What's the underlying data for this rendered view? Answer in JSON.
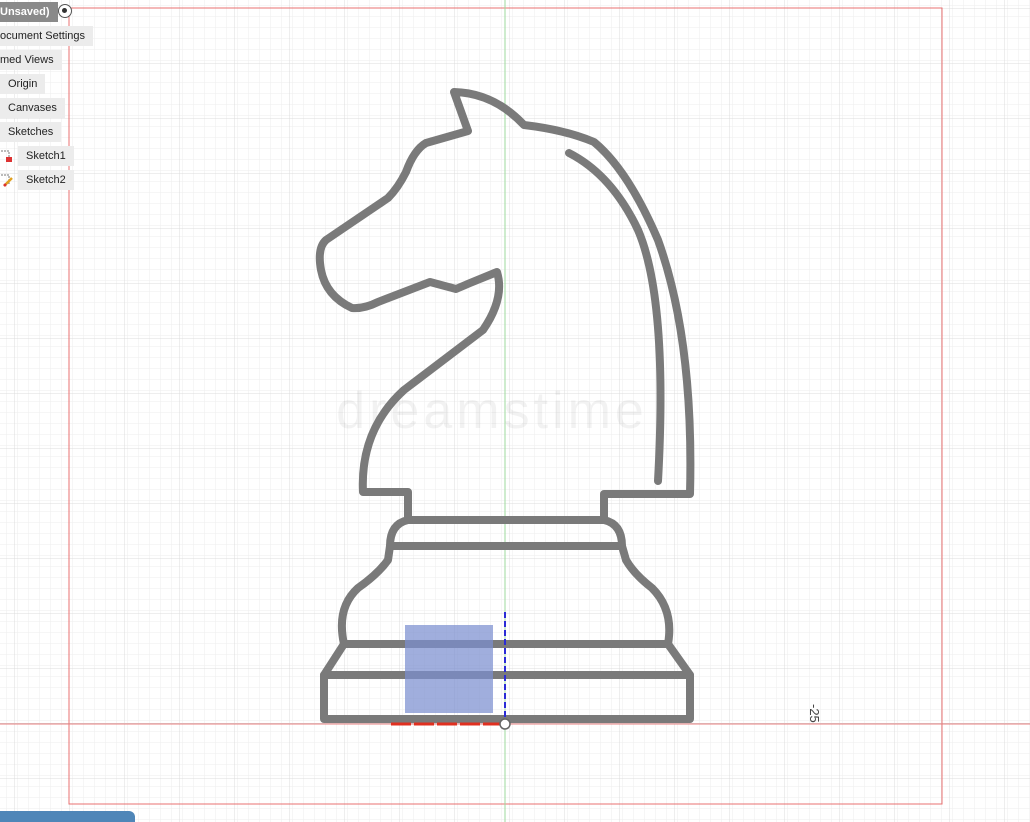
{
  "browser": {
    "title": "Unsaved)",
    "items": [
      {
        "label": "ocument Settings"
      },
      {
        "label": "med Views"
      },
      {
        "label": "Origin"
      },
      {
        "label": "Canvases"
      },
      {
        "label": "Sketches"
      },
      {
        "label": "Sketch1",
        "icon": "sketch-icon"
      },
      {
        "label": "Sketch2",
        "icon": "sketch-icon"
      }
    ]
  },
  "canvas": {
    "dimension_label": "-25",
    "watermark": "dreamstime",
    "colors": {
      "grid": "#e9e9e9",
      "frame": "#e87070",
      "axis_green": "#9ed99e",
      "axis_red": "#e05050",
      "outline": "#7a7a7a",
      "selection": "#7b8fd0",
      "dashed_blue": "#2b2bd6",
      "origin_red": "#e03020"
    }
  }
}
